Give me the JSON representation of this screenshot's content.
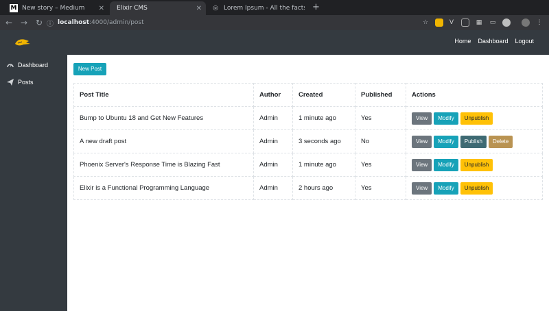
{
  "browser": {
    "tabs": [
      {
        "title": "New story – Medium",
        "favicon": "M"
      },
      {
        "title": "Elixir CMS",
        "favicon": ""
      },
      {
        "title": "Lorem Ipsum - All the facts - L",
        "favicon": "globe"
      }
    ],
    "url_host": "localhost",
    "url_path": ":4000/admin/post"
  },
  "navbar": {
    "links": [
      "Home",
      "Dashboard",
      "Logout"
    ]
  },
  "sidebar": {
    "items": [
      {
        "label": "Dashboard",
        "icon": "dashboard-icon"
      },
      {
        "label": "Posts",
        "icon": "paper-plane-icon"
      }
    ]
  },
  "main": {
    "new_post_label": "New Post",
    "columns": [
      "Post Title",
      "Author",
      "Created",
      "Published",
      "Actions"
    ],
    "rows": [
      {
        "title": "Bump to Ubuntu 18 and Get New Features",
        "author": "Admin",
        "created": "1 minute ago",
        "published": "Yes",
        "actions": [
          "View",
          "Modify",
          "Unpublish"
        ]
      },
      {
        "title": "A new draft post",
        "author": "Admin",
        "created": "3 seconds ago",
        "published": "No",
        "actions": [
          "View",
          "Modify",
          "Publish",
          "Delete"
        ]
      },
      {
        "title": "Phoenix Server's Response Time is Blazing Fast",
        "author": "Admin",
        "created": "1 minute ago",
        "published": "Yes",
        "actions": [
          "View",
          "Modify",
          "Unpublish"
        ]
      },
      {
        "title": "Elixir is a Functional Programming Language",
        "author": "Admin",
        "created": "2 hours ago",
        "published": "Yes",
        "actions": [
          "View",
          "Modify",
          "Unpublish"
        ]
      }
    ]
  },
  "colors": {
    "nav_bg": "#343a40",
    "info": "#17a2b8",
    "secondary": "#6c757d",
    "warning": "#ffc107"
  }
}
